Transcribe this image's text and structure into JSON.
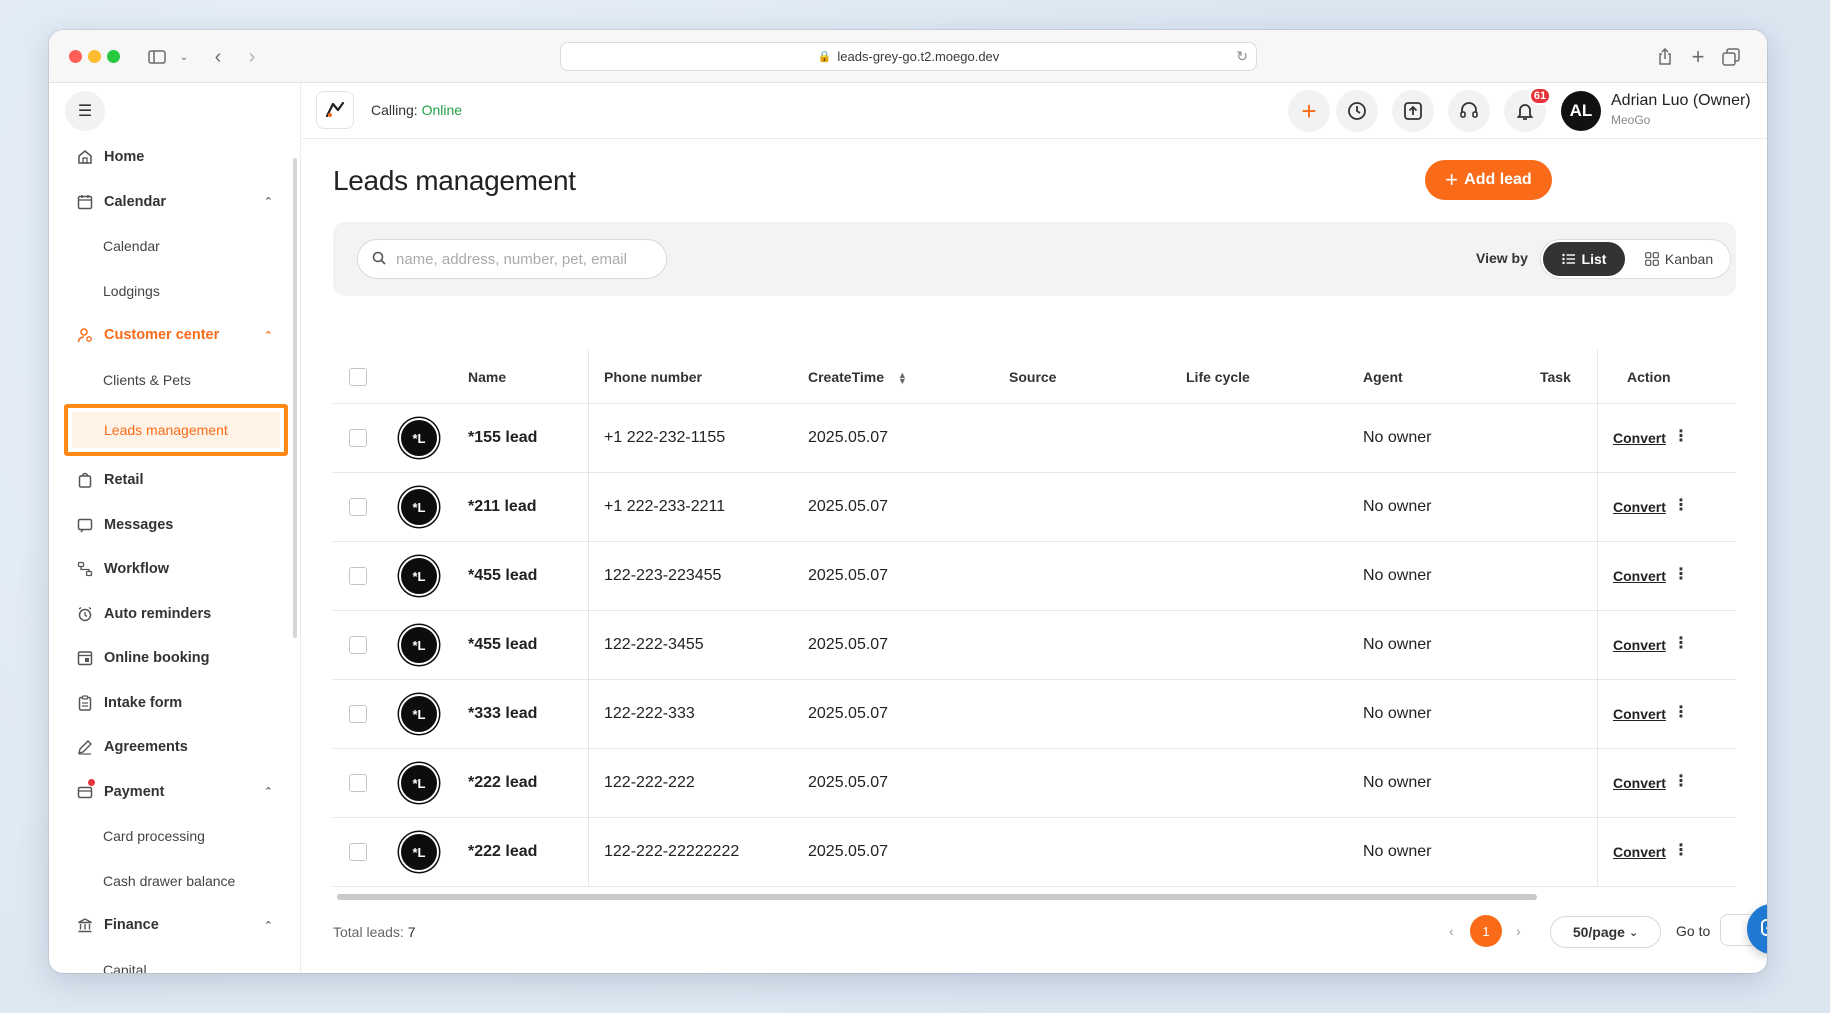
{
  "browser": {
    "url": "leads-grey-go.t2.moego.dev"
  },
  "sidebar": {
    "items": [
      {
        "label": "Home",
        "icon": "home-icon"
      },
      {
        "label": "Calendar",
        "icon": "calendar-icon",
        "expanded": true,
        "children": [
          {
            "label": "Calendar"
          },
          {
            "label": "Lodgings"
          }
        ]
      },
      {
        "label": "Customer center",
        "icon": "customer-icon",
        "expanded": true,
        "active": true,
        "children": [
          {
            "label": "Clients & Pets"
          },
          {
            "label": "Leads management",
            "selected": true
          }
        ]
      },
      {
        "label": "Retail",
        "icon": "retail-icon"
      },
      {
        "label": "Messages",
        "icon": "message-icon"
      },
      {
        "label": "Workflow",
        "icon": "workflow-icon"
      },
      {
        "label": "Auto reminders",
        "icon": "alarm-icon"
      },
      {
        "label": "Online booking",
        "icon": "booking-icon"
      },
      {
        "label": "Intake form",
        "icon": "clipboard-icon"
      },
      {
        "label": "Agreements",
        "icon": "pen-icon"
      },
      {
        "label": "Payment",
        "icon": "payment-icon",
        "expanded": true,
        "has_dot": true,
        "children": [
          {
            "label": "Card processing"
          },
          {
            "label": "Cash drawer balance"
          }
        ]
      },
      {
        "label": "Finance",
        "icon": "bank-icon",
        "expanded": true,
        "children": [
          {
            "label": "Capital"
          }
        ]
      }
    ]
  },
  "header": {
    "calling_label": "Calling:",
    "calling_status": "Online",
    "notification_count": "61",
    "user": {
      "initials": "AL",
      "name": "Adrian Luo (Owner)",
      "org": "MeoGo"
    }
  },
  "main": {
    "title": "Leads management",
    "add_lead_label": "Add lead",
    "search_placeholder": "name, address, number, pet, email",
    "view_by_label": "View by",
    "view_options": [
      "List",
      "Kanban"
    ],
    "selected_view": "List"
  },
  "table": {
    "columns": [
      "Name",
      "Phone number",
      "CreateTime",
      "Source",
      "Life cycle",
      "Agent",
      "Task",
      "Action"
    ],
    "rows": [
      {
        "avatar": "*L",
        "name": "*155 lead",
        "phone": "+1 222-232-1155",
        "create_time": "2025.05.07",
        "source": "",
        "life_cycle": "",
        "agent": "No owner",
        "task": "",
        "action": "Convert"
      },
      {
        "avatar": "*L",
        "name": "*211 lead",
        "phone": "+1 222-233-2211",
        "create_time": "2025.05.07",
        "source": "",
        "life_cycle": "",
        "agent": "No owner",
        "task": "",
        "action": "Convert"
      },
      {
        "avatar": "*L",
        "name": "*455 lead",
        "phone": "122-223-223455",
        "create_time": "2025.05.07",
        "source": "",
        "life_cycle": "",
        "agent": "No owner",
        "task": "",
        "action": "Convert"
      },
      {
        "avatar": "*L",
        "name": "*455 lead",
        "phone": "122-222-3455",
        "create_time": "2025.05.07",
        "source": "",
        "life_cycle": "",
        "agent": "No owner",
        "task": "",
        "action": "Convert"
      },
      {
        "avatar": "*L",
        "name": "*333 lead",
        "phone": "122-222-333",
        "create_time": "2025.05.07",
        "source": "",
        "life_cycle": "",
        "agent": "No owner",
        "task": "",
        "action": "Convert"
      },
      {
        "avatar": "*L",
        "name": "*222 lead",
        "phone": "122-222-222",
        "create_time": "2025.05.07",
        "source": "",
        "life_cycle": "",
        "agent": "No owner",
        "task": "",
        "action": "Convert"
      },
      {
        "avatar": "*L",
        "name": "*222 lead",
        "phone": "122-222-22222222",
        "create_time": "2025.05.07",
        "source": "",
        "life_cycle": "",
        "agent": "No owner",
        "task": "",
        "action": "Convert"
      }
    ]
  },
  "footer": {
    "total_label": "Total leads:",
    "total_count": "7",
    "current_page": "1",
    "page_size": "50/page",
    "goto_label": "Go to"
  },
  "colors": {
    "accent": "#f96b18",
    "online": "#24a148",
    "badge": "#e5343a",
    "chat": "#1f78d1"
  }
}
